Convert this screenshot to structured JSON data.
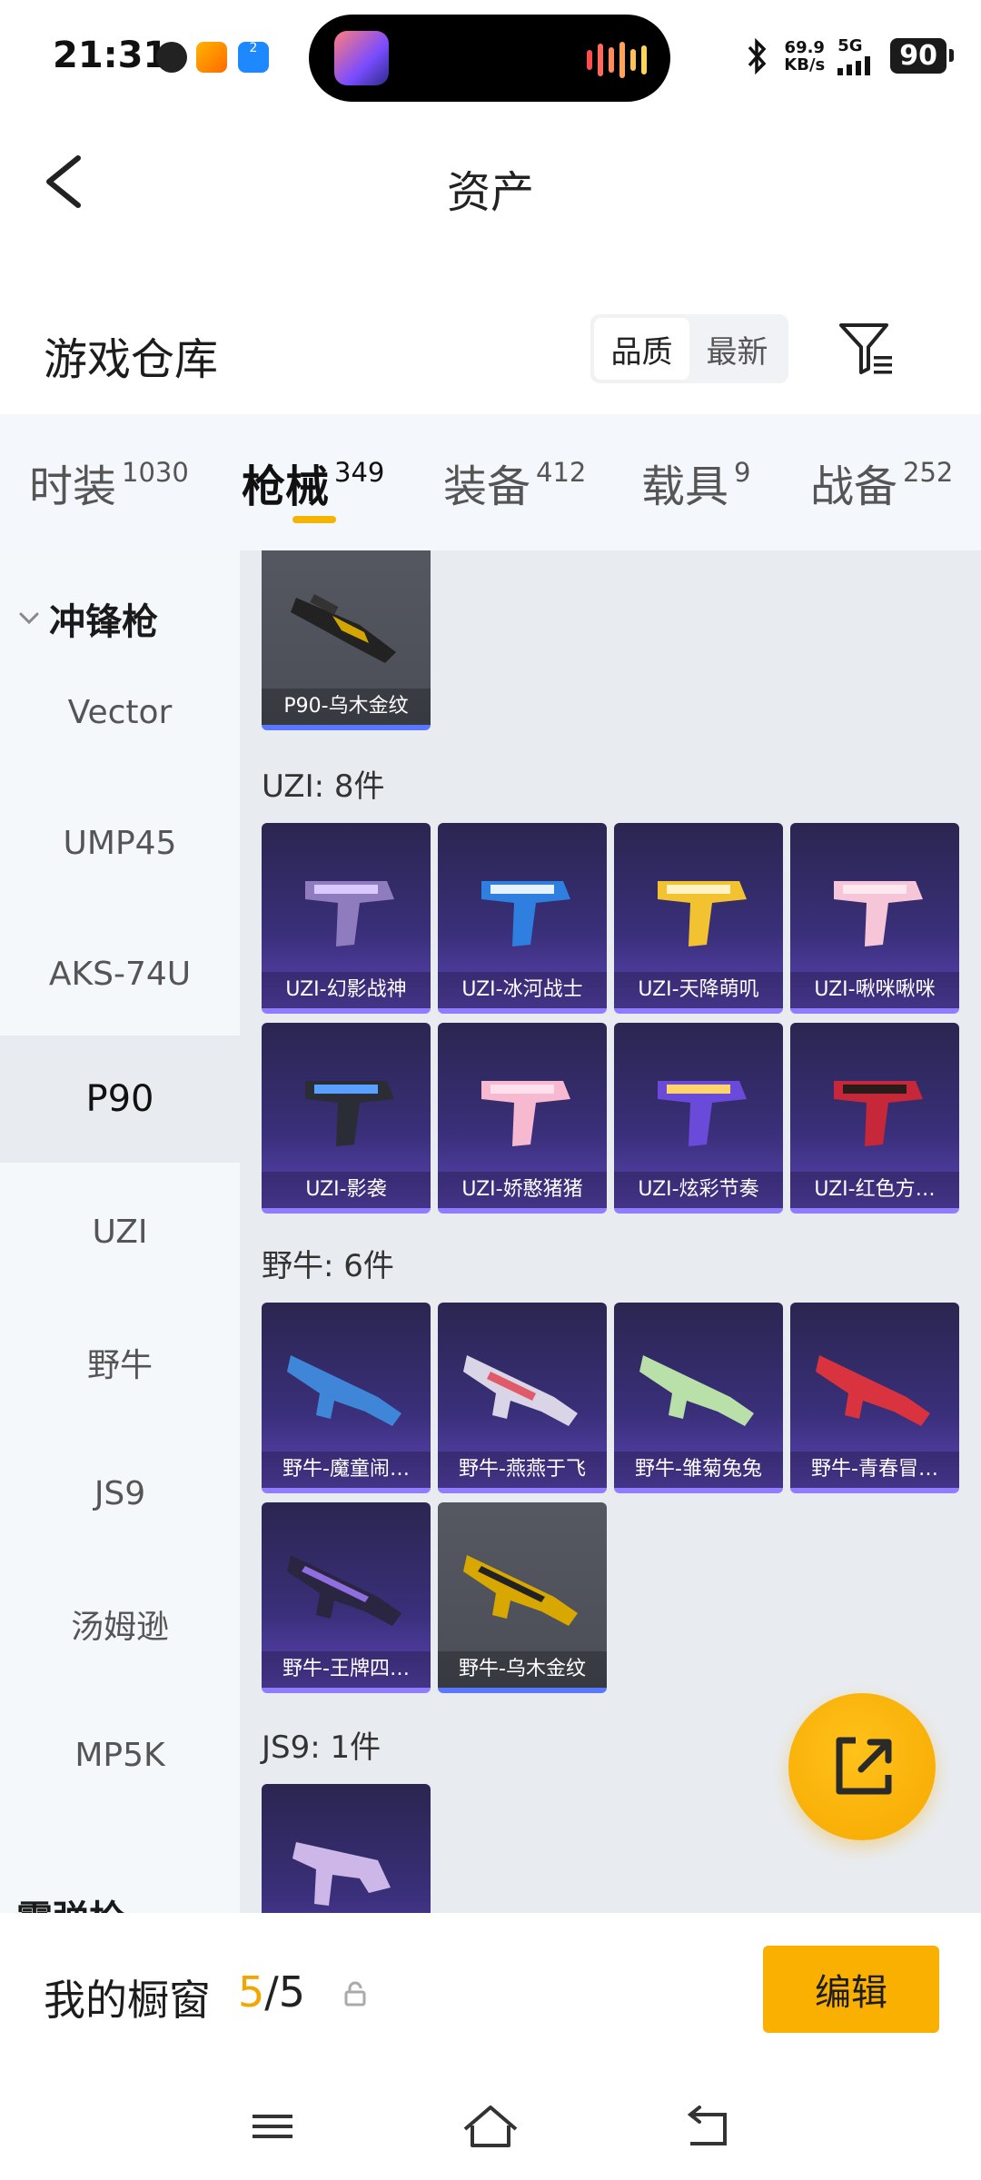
{
  "status_bar": {
    "time": "21:31",
    "net_speed_value": "69.9",
    "net_speed_unit": "KB/s",
    "network": "5G",
    "battery": "90",
    "notif_badge": "2"
  },
  "header": {
    "title": "资产"
  },
  "warehouse": {
    "title": "游戏仓库",
    "sort_options": [
      "品质",
      "最新"
    ],
    "sort_active": "品质"
  },
  "tabs": [
    {
      "label": "时装",
      "count": "1030"
    },
    {
      "label": "枪械",
      "count": "349"
    },
    {
      "label": "装备",
      "count": "412"
    },
    {
      "label": "载具",
      "count": "9"
    },
    {
      "label": "战备",
      "count": "252"
    }
  ],
  "sidebar": {
    "group": "冲锋枪",
    "items": [
      "Vector",
      "UMP45",
      "AKS-74U",
      "P90",
      "UZI",
      "野牛",
      "JS9",
      "汤姆逊",
      "MP5K"
    ],
    "active": "P90",
    "next_group_partial": "霰弹枪"
  },
  "content": {
    "p90_cards": [
      "P90-乌木金纹"
    ],
    "uzi_title": "UZI: 8件",
    "uzi_cards": [
      "UZI-幻影战神",
      "UZI-冰河战士",
      "UZI-天降萌叽",
      "UZI-啾咪啾咪",
      "UZI-影袭",
      "UZI-娇憨猪猪",
      "UZI-炫彩节奏",
      "UZI-红色方…"
    ],
    "bison_title": "野牛: 6件",
    "bison_cards": [
      "野牛-魔童闹…",
      "野牛-燕燕于飞",
      "野牛-雏菊兔兔",
      "野牛-青春冒…",
      "野牛-王牌四…",
      "野牛-乌木金纹"
    ],
    "js9_title": "JS9: 1件"
  },
  "showcase": {
    "label": "我的橱窗",
    "current": "5",
    "separator": "/",
    "total": "5",
    "edit_label": "编辑"
  },
  "colors": {
    "accent": "#F9B000",
    "card_purple": "#3A2F7A",
    "card_gold": "#4B4E57",
    "sidebar_bg": "#F5F8FB",
    "content_bg": "#E8ECF1"
  }
}
